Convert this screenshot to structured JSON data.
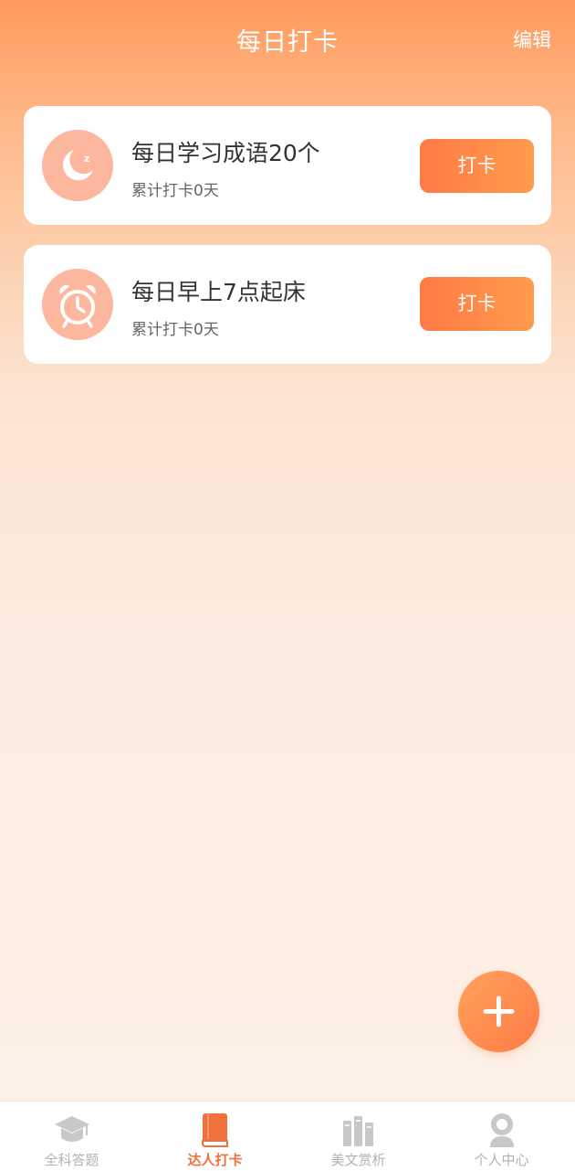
{
  "header": {
    "title": "每日打卡",
    "edit_label": "编辑"
  },
  "cards": [
    {
      "icon": "moon-sleep-icon",
      "title": "每日学习成语20个",
      "subtitle": "累计打卡0天",
      "button_label": "打卡"
    },
    {
      "icon": "alarm-clock-icon",
      "title": "每日早上7点起床",
      "subtitle": "累计打卡0天",
      "button_label": "打卡"
    }
  ],
  "fab": {
    "icon": "plus-icon"
  },
  "tabbar": {
    "active_index": 1,
    "tabs": [
      {
        "label": "全科答题",
        "icon": "graduation-cap-icon"
      },
      {
        "label": "达人打卡",
        "icon": "book-icon"
      },
      {
        "label": "美文赏析",
        "icon": "bookshelf-icon"
      },
      {
        "label": "个人中心",
        "icon": "user-icon"
      }
    ]
  },
  "colors": {
    "accent": "#ff7a45",
    "icon_circle": "#fdb79e",
    "tab_active": "#f2703e",
    "tab_inactive": "#c8c8c8"
  }
}
